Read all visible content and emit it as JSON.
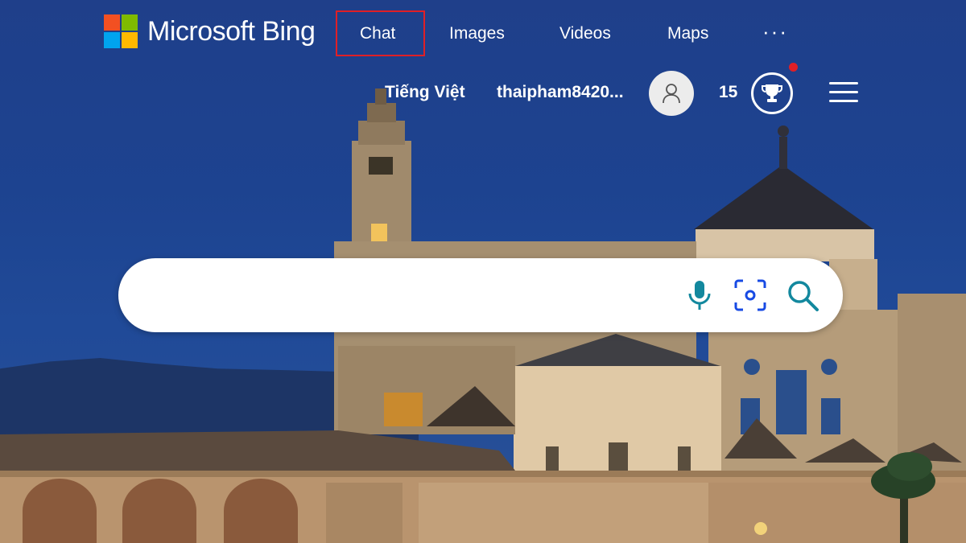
{
  "brand": {
    "name": "Microsoft Bing",
    "logo_colors": [
      "#f25022",
      "#7fba00",
      "#00a4ef",
      "#ffb900"
    ]
  },
  "nav": {
    "items": [
      {
        "label": "Chat",
        "highlighted": true
      },
      {
        "label": "Images"
      },
      {
        "label": "Videos"
      },
      {
        "label": "Maps"
      },
      {
        "label": "···"
      }
    ],
    "highlight_color": "#e01f26"
  },
  "topbar": {
    "language": "Tiếng Việt",
    "username": "thaipham8420...",
    "avatar_icon": "user-icon",
    "rewards_points": "15",
    "rewards_icon": "trophy-icon",
    "notification_color": "#e01f26",
    "menu_icon": "hamburger-icon"
  },
  "search": {
    "value": "",
    "placeholder": "",
    "buttons": [
      {
        "icon": "microphone-icon"
      },
      {
        "icon": "visual-search-icon"
      },
      {
        "icon": "search-icon"
      }
    ],
    "icon_colors": {
      "mic": "#13889e",
      "camera": "#174ae4",
      "search": "#13889e"
    }
  },
  "background": {
    "description_colors": {
      "sky": "#1f4592",
      "stone": "#c9a97e"
    }
  }
}
